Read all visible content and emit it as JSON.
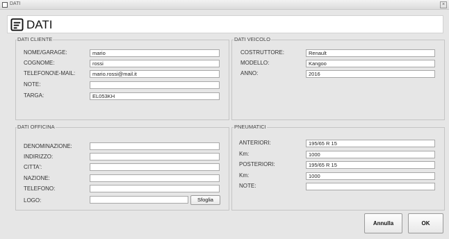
{
  "window": {
    "title": "DATI"
  },
  "header": {
    "title": "DATI"
  },
  "cliente": {
    "legend": "DATI CLIENTE",
    "fields": [
      {
        "label": "NOME/GARAGE:",
        "value": "mario"
      },
      {
        "label": "COGNOME:",
        "value": "rossi"
      },
      {
        "label": "TELEFONO\\E-MAIL:",
        "value": "mario.rossi@mail.it"
      },
      {
        "label": "NOTE:",
        "value": ""
      },
      {
        "label": "TARGA:",
        "value": "EL053KH"
      }
    ]
  },
  "veicolo": {
    "legend": "DATI VEICOLO",
    "fields": [
      {
        "label": "COSTRUTTORE:",
        "value": "Renault"
      },
      {
        "label": "MODELLO:",
        "value": "Kangoo"
      },
      {
        "label": "ANNO:",
        "value": "2016"
      }
    ]
  },
  "officina": {
    "legend": "DATI OFFICINA",
    "fields": [
      {
        "label": "DENOMINAZIONE:",
        "value": ""
      },
      {
        "label": "INDIRIZZO:",
        "value": ""
      },
      {
        "label": "CITTA':",
        "value": ""
      },
      {
        "label": "NAZIONE:",
        "value": ""
      },
      {
        "label": "TELEFONO:",
        "value": ""
      },
      {
        "label": "LOGO:",
        "value": ""
      }
    ],
    "browse_label": "Sfoglia"
  },
  "pneumatici": {
    "legend": "PNEUMATICI",
    "fields": [
      {
        "label": "ANTERIORI:",
        "value": "195/65 R 15"
      },
      {
        "label": "Km:",
        "value": "1000"
      },
      {
        "label": "POSTERIORI:",
        "value": "195/65 R 15"
      },
      {
        "label": "Km:",
        "value": "1000"
      },
      {
        "label": "NOTE:",
        "value": ""
      }
    ]
  },
  "actions": {
    "cancel_label": "Annulla",
    "ok_label": "OK"
  }
}
